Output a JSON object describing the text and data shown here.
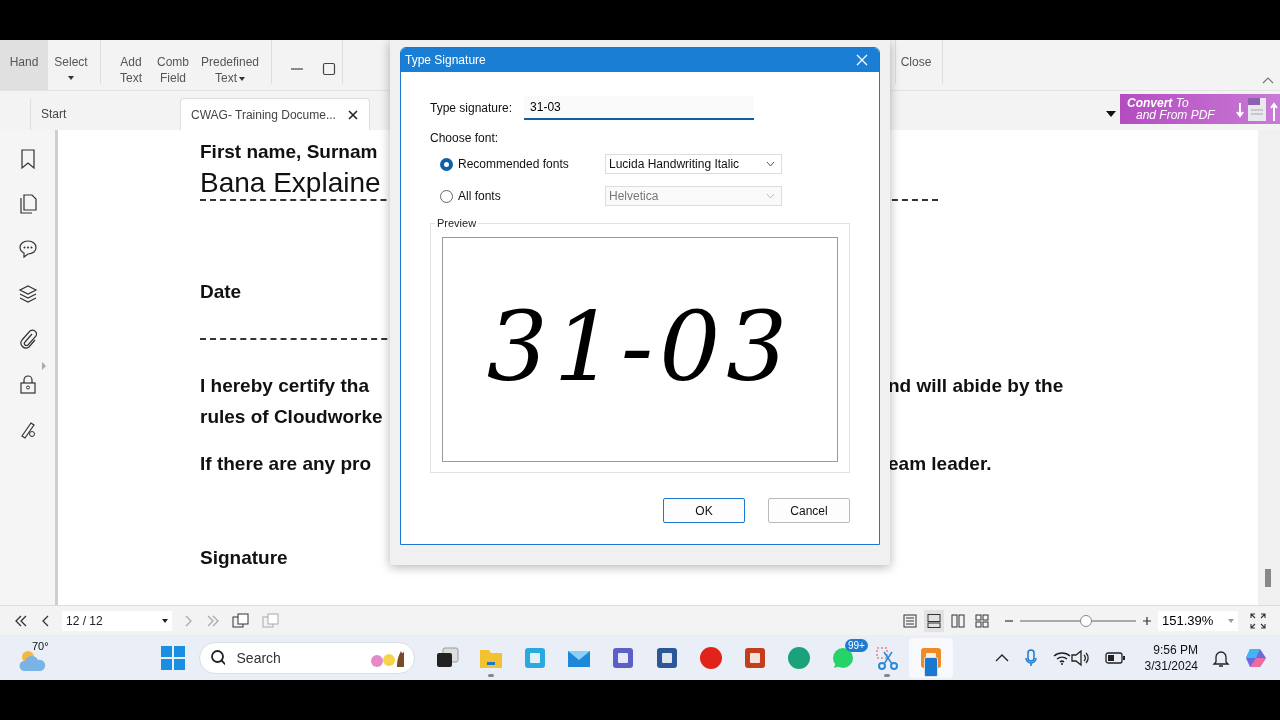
{
  "toolbar": {
    "items": [
      {
        "label": "Hand",
        "selected": true,
        "kind": "button"
      },
      {
        "label": "Select",
        "selected": false,
        "kind": "menu_below"
      },
      {
        "label": "Add Text",
        "selected": false,
        "kind": "button"
      },
      {
        "label": "Comb Field",
        "selected": false,
        "kind": "button"
      },
      {
        "label": "Predefined Text",
        "selected": false,
        "kind": "menu_inline"
      }
    ],
    "close_label": "Close"
  },
  "tabs": [
    {
      "label": "Start",
      "selected": false,
      "closable": false
    },
    {
      "label": "CWAG- Training Docume...",
      "selected": true,
      "closable": true
    }
  ],
  "promo": {
    "line1": "**Convert** To",
    "line2": "and From PDF"
  },
  "document": {
    "name_label": "First name, Surnam",
    "name_value": "Bana Explaine",
    "date_label": "Date",
    "certify_left": [
      "I hereby certify tha",
      "rules of Cloudworke"
    ],
    "certify_right": "nd will abide by the",
    "contact_left": "If there are any pro",
    "contact_right": "eam leader.",
    "signature_label": "Signature"
  },
  "dialog": {
    "title": "Type Signature",
    "signature_label": "Type signature:",
    "signature_value": "31-03",
    "choose_font_label": "Choose font:",
    "font_options": [
      {
        "label": "Recommended fonts",
        "selected": true,
        "font": "Lucida Handwriting Italic",
        "disabled": false
      },
      {
        "label": "All fonts",
        "selected": false,
        "font": "Helvetica",
        "disabled": true
      }
    ],
    "preview_label": "Preview",
    "preview_text": "31-03",
    "buttons": [
      {
        "label": "OK",
        "default": true
      },
      {
        "label": "Cancel",
        "default": false
      }
    ]
  },
  "status_bar": {
    "page": "12 / 12",
    "views": [
      {
        "kind": "single",
        "selected": false
      },
      {
        "kind": "continuous",
        "selected": true
      },
      {
        "kind": "facing",
        "selected": false
      },
      {
        "kind": "grid",
        "selected": false
      }
    ],
    "zoom_slider": {
      "level": 0.57
    },
    "zoom": "151.39%"
  },
  "taskbar": {
    "weather": "70°",
    "search": {
      "placeholder": "Search"
    },
    "apps": [
      {
        "kind": "taskview",
        "running": false,
        "selected": false
      },
      {
        "kind": "folder",
        "running": true,
        "selected": false
      },
      {
        "kind": "hp",
        "running": false,
        "selected": false
      },
      {
        "kind": "mail",
        "running": false,
        "selected": false
      },
      {
        "kind": "teams",
        "running": false,
        "selected": false
      },
      {
        "kind": "word",
        "running": false,
        "selected": false
      },
      {
        "kind": "wps",
        "running": false,
        "selected": false
      },
      {
        "kind": "powerpoint",
        "running": false,
        "selected": false
      },
      {
        "kind": "edge",
        "running": false,
        "selected": false
      },
      {
        "kind": "whatsapp",
        "running": false,
        "selected": false,
        "badge": "99+"
      },
      {
        "kind": "snip",
        "running": true,
        "selected": false
      },
      {
        "kind": "pdf",
        "running": true,
        "selected": true
      }
    ],
    "time": "9:56 PM",
    "date": "3/31/2024"
  }
}
